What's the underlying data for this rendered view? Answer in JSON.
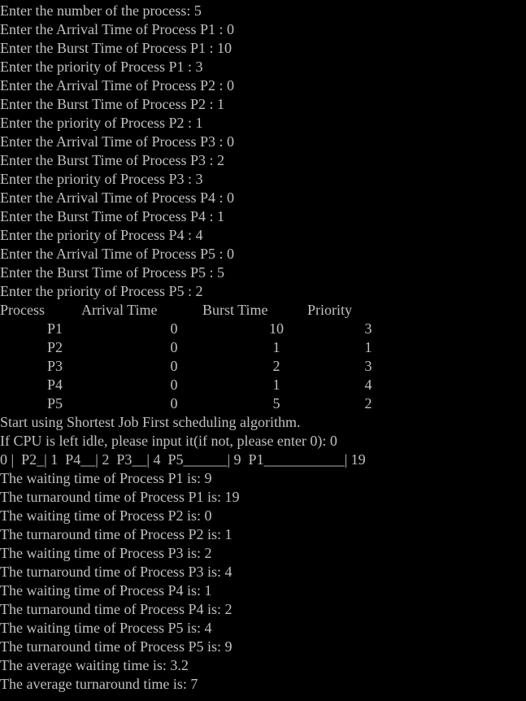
{
  "input_lines": [
    "Enter the number of the process: 5",
    "Enter the Arrival Time of Process P1 : 0",
    "Enter the Burst Time of Process P1 : 10",
    "Enter the priority of Process P1 : 3",
    "Enter the Arrival Time of Process P2 : 0",
    "Enter the Burst Time of Process P2 : 1",
    "Enter the priority of Process P2 : 1",
    "Enter the Arrival Time of Process P3 : 0",
    "Enter the Burst Time of Process P3 : 2",
    "Enter the priority of Process P3 : 3",
    "Enter the Arrival Time of Process P4 : 0",
    "Enter the Burst Time of Process P4 : 1",
    "Enter the priority of Process P4 : 4",
    "Enter the Arrival Time of Process P5 : 0",
    "Enter the Burst Time of Process P5 : 5",
    "Enter the priority of Process P5 : 2"
  ],
  "table": {
    "headers": {
      "process": "Process",
      "arrival": "Arrival Time",
      "burst": "Burst Time",
      "priority": "Priority"
    },
    "rows": [
      {
        "process": "P1",
        "arrival": "0",
        "burst": "10",
        "priority": "3"
      },
      {
        "process": "P2",
        "arrival": "0",
        "burst": "1",
        "priority": "1"
      },
      {
        "process": "P3",
        "arrival": "0",
        "burst": "2",
        "priority": "3"
      },
      {
        "process": "P4",
        "arrival": "0",
        "burst": "1",
        "priority": "4"
      },
      {
        "process": "P5",
        "arrival": "0",
        "burst": "5",
        "priority": "2"
      }
    ]
  },
  "output_lines": [
    "Start using Shortest Job First scheduling algorithm.",
    "If CPU is left idle, please input it(if not, please enter 0): 0",
    "0 |  P2_| 1  P4__| 2  P3__| 4  P5______| 9  P1___________| 19",
    "The waiting time of Process P1 is: 9",
    "The turnaround time of Process P1 is: 19",
    "The waiting time of Process P2 is: 0",
    "The turnaround time of Process P2 is: 1",
    "The waiting time of Process P3 is: 2",
    "The turnaround time of Process P3 is: 4",
    "The waiting time of Process P4 is: 1",
    "The turnaround time of Process P4 is: 2",
    "The waiting time of Process P5 is: 4",
    "The turnaround time of Process P5 is: 9",
    "The average waiting time is: 3.2",
    "The average turnaround time is: 7"
  ],
  "colors": {
    "background": "#000000",
    "text": "#c0c0c0"
  }
}
